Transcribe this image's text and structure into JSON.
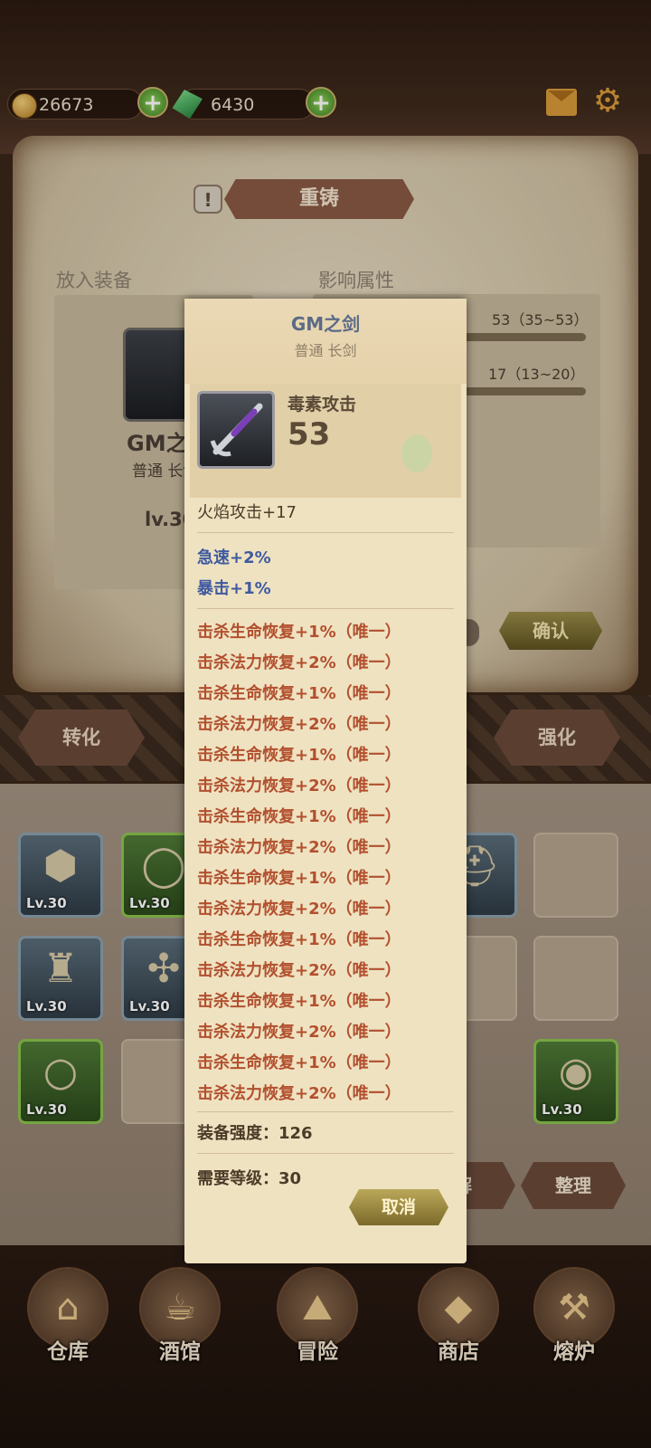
{
  "resources": {
    "gold": "26673",
    "gems": "6430"
  },
  "forge": {
    "title": "重铸",
    "put_equipment_label": "放入装备",
    "affect_attr_label": "影响属性",
    "stat1_value": "53（35~53）",
    "stat2_value": "17（13~20）",
    "equipment_name": "GM之剑",
    "equipment_sub": "普通 长剑",
    "equipment_level": "lv.30",
    "confirm_label": "确认"
  },
  "tabs": {
    "convert": "转化",
    "enhance": "强化"
  },
  "inventory": {
    "items": [
      {
        "level": "Lv.30",
        "icon": "nut-icon",
        "rarity": "blue"
      },
      {
        "level": "Lv.30",
        "icon": "ring-icon",
        "rarity": "green"
      },
      {
        "level": "30",
        "icon": "helmet-icon",
        "rarity": "blue"
      },
      {
        "level": "Lv.30",
        "icon": "armor-icon",
        "rarity": "blue"
      },
      {
        "level": "Lv.30",
        "icon": "claw-icon",
        "rarity": "blue"
      },
      {
        "level": "Lv.30",
        "icon": "silver-ring-icon",
        "rarity": "green"
      },
      {
        "level": "Lv.30",
        "icon": "shield-icon",
        "rarity": "green"
      }
    ],
    "decompose_label": "解",
    "sort_label": "整理"
  },
  "nav": {
    "warehouse": "仓库",
    "tavern": "酒馆",
    "adventure": "冒险",
    "shop": "商店",
    "forge": "熔炉",
    "badge": "!"
  },
  "tooltip": {
    "name": "GM之剑",
    "type": "普通 长剑",
    "main_attr_label": "毒素攻击",
    "main_attr_value": "53",
    "fire_attack": "火焰攻击+17",
    "blue_stats": [
      "急速+2%",
      "暴击+1%"
    ],
    "unique_stats": [
      "击杀生命恢复+1%（唯一）",
      "击杀法力恢复+2%（唯一）",
      "击杀生命恢复+1%（唯一）",
      "击杀法力恢复+2%（唯一）",
      "击杀生命恢复+1%（唯一）",
      "击杀法力恢复+2%（唯一）",
      "击杀生命恢复+1%（唯一）",
      "击杀法力恢复+2%（唯一）",
      "击杀生命恢复+1%（唯一）",
      "击杀法力恢复+2%（唯一）",
      "击杀生命恢复+1%（唯一）",
      "击杀法力恢复+2%（唯一）",
      "击杀生命恢复+1%（唯一）",
      "击杀法力恢复+2%（唯一）",
      "击杀生命恢复+1%（唯一）",
      "击杀法力恢复+2%（唯一）"
    ],
    "strength": "装备强度：126",
    "required_level": "需要等级：30",
    "cancel_label": "取消"
  },
  "colors": {
    "blue_stat": "#3f5aa0",
    "unique_stat": "#b2502e",
    "item_name": "#5b6b86"
  }
}
